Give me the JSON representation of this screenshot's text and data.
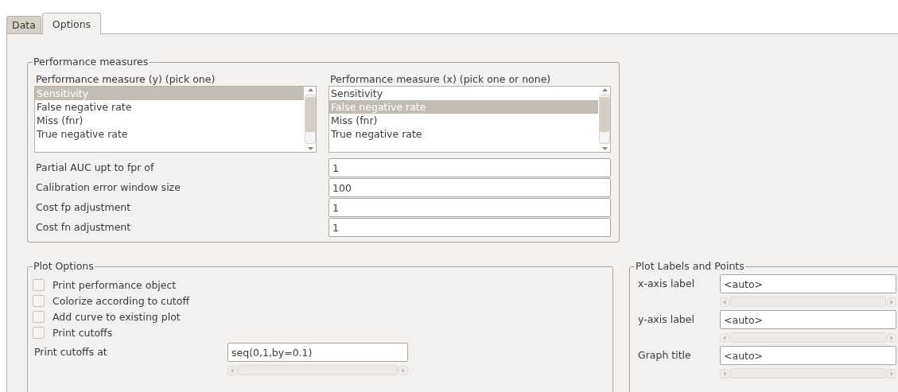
{
  "tabs": [
    {
      "label": "Data",
      "selected": false
    },
    {
      "label": "Options",
      "selected": true
    }
  ],
  "performance_measures": {
    "title": "Performance measures",
    "lists": [
      {
        "label": "Performance measure (y) (pick one)",
        "items": [
          {
            "label": "Sensitivity",
            "selected": true
          },
          {
            "label": "False negative rate",
            "selected": false
          },
          {
            "label": "Miss (fnr)",
            "selected": false
          },
          {
            "label": "True negative rate",
            "selected": false
          }
        ]
      },
      {
        "label": "Performance measure (x) (pick one or none)",
        "items": [
          {
            "label": "Sensitivity",
            "selected": false
          },
          {
            "label": "False negative rate",
            "selected": true
          },
          {
            "label": "Miss (fnr)",
            "selected": false
          },
          {
            "label": "True negative rate",
            "selected": false
          }
        ]
      }
    ],
    "fields": [
      {
        "label": "Partial AUC upt to fpr of",
        "value": "1"
      },
      {
        "label": "Calibration error window size",
        "value": "100"
      },
      {
        "label": "Cost fp adjustment",
        "value": "1"
      },
      {
        "label": "Cost fn adjustment",
        "value": "1"
      }
    ]
  },
  "plot_options": {
    "title": "Plot Options",
    "checks": [
      {
        "label": "Print performance object",
        "checked": false
      },
      {
        "label": "Colorize according to cutoff",
        "checked": false
      },
      {
        "label": "Add curve to existing plot",
        "checked": false
      },
      {
        "label": "Print cutoffs",
        "checked": false
      }
    ],
    "fields": [
      {
        "label": "Print cutoffs at",
        "value": "seq(0,1,by=0.1)"
      }
    ]
  },
  "plot_labels": {
    "title": "Plot Labels and Points",
    "fields": [
      {
        "label": "x-axis label",
        "value": "<auto>"
      },
      {
        "label": "y-axis label",
        "value": "<auto>"
      },
      {
        "label": "Graph title",
        "value": "<auto>"
      }
    ]
  }
}
